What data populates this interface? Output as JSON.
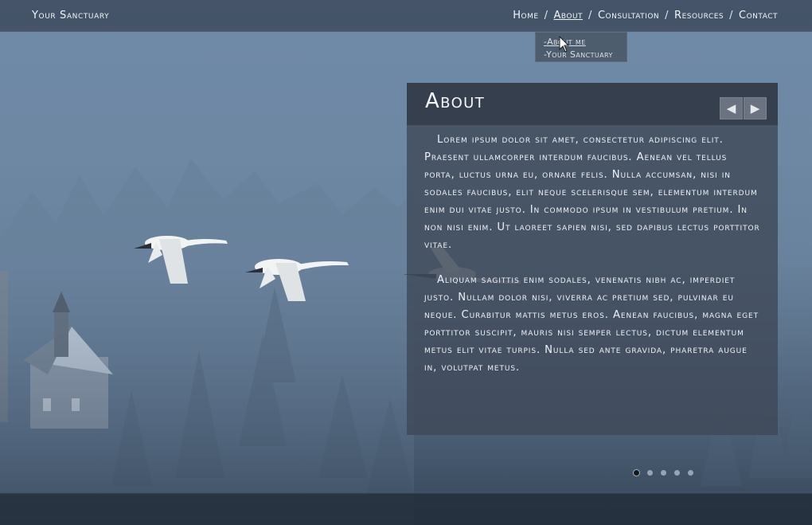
{
  "site": {
    "brand": "Your Sanctuary"
  },
  "nav": {
    "items": [
      {
        "label": "Home"
      },
      {
        "label": "About",
        "active": true
      },
      {
        "label": "Consultation"
      },
      {
        "label": "Resources"
      },
      {
        "label": "Contact"
      }
    ],
    "separator": "/"
  },
  "about_menu": {
    "items": [
      {
        "label": "-About me"
      },
      {
        "label": "-Your Sanctuary"
      }
    ]
  },
  "panel": {
    "title": "About",
    "prev_icon": "arrow-left-icon",
    "next_icon": "arrow-right-icon",
    "paragraphs": [
      "Lorem ipsum dolor sit amet, consectetur adipiscing elit. Praesent ullamcorper interdum faucibus. Aenean vel tellus porta, luctus urna eu, ornare felis. Nulla accumsan, nisi in sodales faucibus, elit neque scelerisque sem, elementum interdum enim dui vitae justo. In commodo ipsum in vestibulum pretium. In non nisi enim. Ut laoreet sapien nisi, sed dapibus lectus porttitor vitae.",
      "Aliquam sagittis enim sodales, venenatis nibh ac, imperdiet justo. Nullam dolor nisi, viverra ac pretium sed, pulvinar eu neque. Curabitur mattis metus eros. Aenean faucibus, magna eget porttitor suscipit, mauris nisi semper lectus, dictum elementum metus elit vitae turpis. Nulla sed ante gravida, pharetra augue in, volutpat metus."
    ]
  },
  "slider": {
    "count": 5,
    "active_index": 0
  },
  "colors": {
    "panel": "#3e4858",
    "topbar": "#344050",
    "text": "#eef1f5"
  }
}
